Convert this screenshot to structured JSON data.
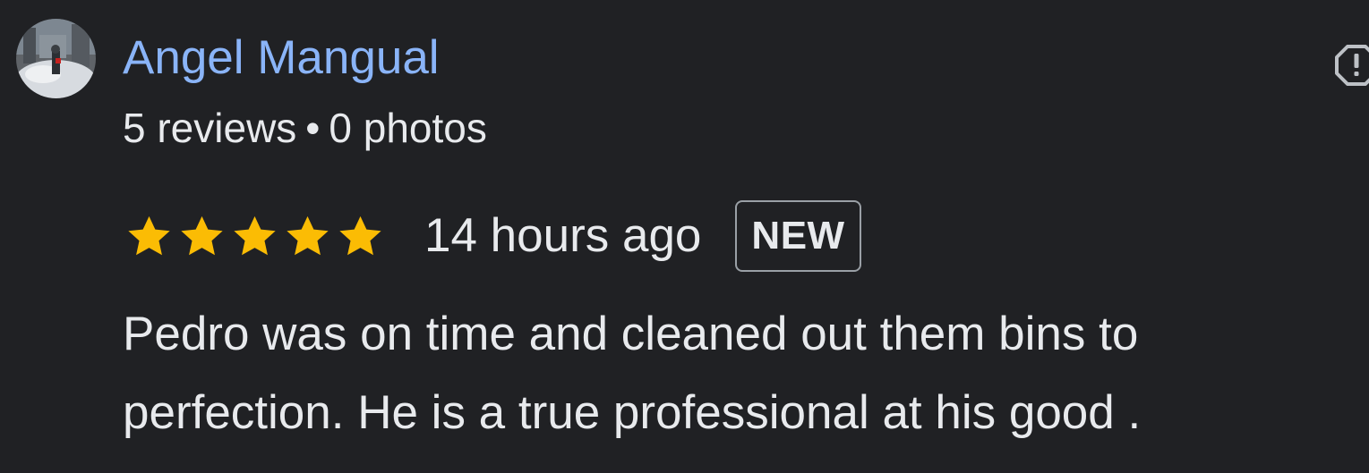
{
  "review": {
    "reviewer_name": "Angel Mangual",
    "reviews_count": "5 reviews",
    "separator": "•",
    "photos_count": "0 photos",
    "rating": 5,
    "rating_max": 5,
    "time_ago": "14 hours ago",
    "badge": "NEW",
    "text_line_1": "Pedro was on time and cleaned out them bins to",
    "text_line_2": "perfection. He is a true professional at his good ."
  },
  "icons": {
    "avatar": "avatar-photo",
    "star": "star-icon",
    "report": "report-flag-icon"
  },
  "colors": {
    "background": "#202124",
    "name_link": "#8ab4f8",
    "text": "#e8eaed",
    "star": "#fbbc04",
    "badge_border": "#9aa0a6"
  }
}
